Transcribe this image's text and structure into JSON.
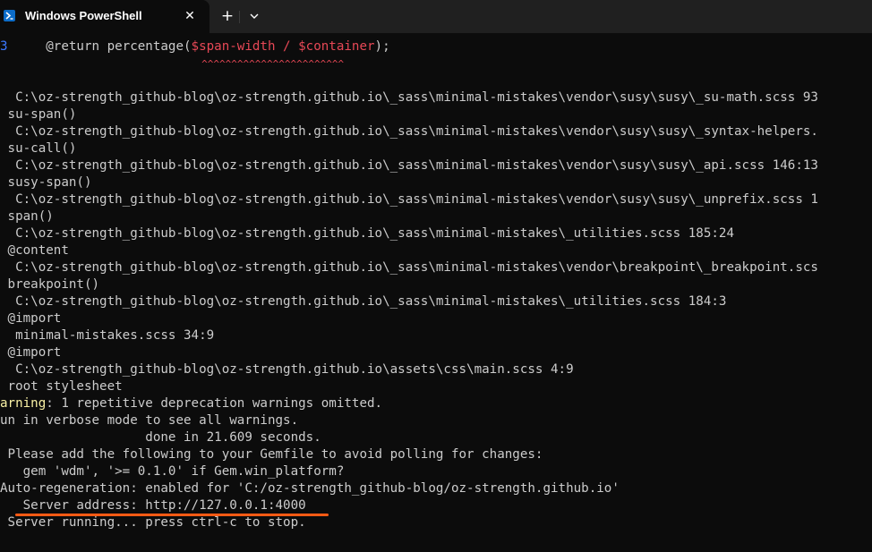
{
  "window": {
    "tab_title": "Windows PowerShell",
    "close_symbol": "✕",
    "new_tab_symbol": "+",
    "dropdown_icon": "chevron-down-icon",
    "shell_icon": "powershell-icon",
    "accent_color": "#0c6cc8"
  },
  "terminal": {
    "code_line": {
      "gutter": "3",
      "prefix": "     @return percentage(",
      "highlight": "$span-width / $container",
      "suffix": ");"
    },
    "caret_line": "                                  ^^^^^^^^^^^^^^^^^^^^^^^^",
    "lines": [
      "  C:\\oz-strength_github-blog\\oz-strength.github.io\\_sass\\minimal-mistakes\\vendor\\susy\\susy\\_su-math.scss 93",
      " su-span()",
      "  C:\\oz-strength_github-blog\\oz-strength.github.io\\_sass\\minimal-mistakes\\vendor\\susy\\susy\\_syntax-helpers.",
      " su-call()",
      "  C:\\oz-strength_github-blog\\oz-strength.github.io\\_sass\\minimal-mistakes\\vendor\\susy\\susy\\_api.scss 146:13",
      " susy-span()",
      "  C:\\oz-strength_github-blog\\oz-strength.github.io\\_sass\\minimal-mistakes\\vendor\\susy\\susy\\_unprefix.scss 1",
      " span()",
      "  C:\\oz-strength_github-blog\\oz-strength.github.io\\_sass\\minimal-mistakes\\_utilities.scss 185:24",
      " @content",
      "  C:\\oz-strength_github-blog\\oz-strength.github.io\\_sass\\minimal-mistakes\\vendor\\breakpoint\\_breakpoint.scs",
      " breakpoint()",
      "  C:\\oz-strength_github-blog\\oz-strength.github.io\\_sass\\minimal-mistakes\\_utilities.scss 184:3",
      " @import",
      "  minimal-mistakes.scss 34:9",
      " @import",
      "  C:\\oz-strength_github-blog\\oz-strength.github.io\\assets\\css\\main.scss 4:9",
      " root stylesheet"
    ],
    "warning_line": {
      "label": "arning",
      "text": ": 1 repetitive deprecation warnings omitted."
    },
    "tail_lines": [
      "un in verbose mode to see all warnings.",
      "                   done in 21.609 seconds.",
      " Please add the following to your Gemfile to avoid polling for changes:",
      "   gem 'wdm', '>= 0.1.0' if Gem.win_platform?",
      "Auto-regeneration: enabled for 'C:/oz-strength_github-blog/oz-strength.github.io'",
      "   Server address: http://127.0.0.1:4000",
      " Server running... press ctrl-c to stop."
    ],
    "highlight_color": "#ff5a14"
  }
}
